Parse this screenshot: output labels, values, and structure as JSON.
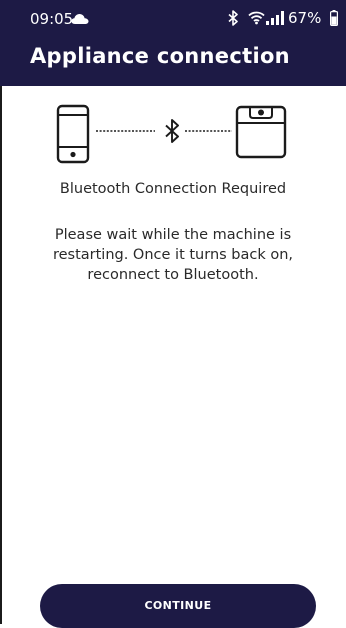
{
  "status_bar": {
    "time": "09:05",
    "battery_percent": "67%",
    "icons": [
      "cloud-icon",
      "bluetooth-icon",
      "wifi-icon",
      "signal-icon",
      "battery-icon"
    ]
  },
  "header": {
    "title": "Appliance connection"
  },
  "illustration": {
    "icons": [
      "phone-icon",
      "bluetooth-icon",
      "appliance-icon"
    ]
  },
  "message": {
    "title": "Bluetooth Connection Required",
    "body": "Please wait while the machine is restarting. Once it turns back on, reconnect to Bluetooth."
  },
  "actions": {
    "continue_label": "CONTINUE"
  },
  "colors": {
    "header_bg": "#1d1a45",
    "button_bg": "#1d1a45",
    "text": "#2a2a2a"
  }
}
